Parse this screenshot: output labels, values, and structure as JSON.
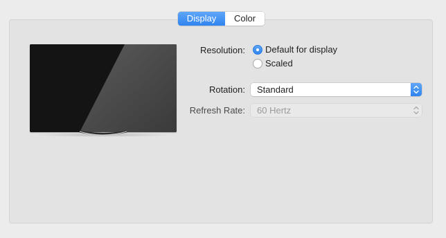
{
  "tabs": [
    {
      "label": "Display",
      "selected": true
    },
    {
      "label": "Color",
      "selected": false
    }
  ],
  "resolution": {
    "label": "Resolution:",
    "options": [
      {
        "label": "Default for display",
        "selected": true
      },
      {
        "label": "Scaled",
        "selected": false
      }
    ]
  },
  "rotation": {
    "label": "Rotation:",
    "value": "Standard",
    "enabled": true
  },
  "refresh_rate": {
    "label": "Refresh Rate:",
    "value": "60 Hertz",
    "enabled": false
  },
  "colors": {
    "accent": "#2f84f0",
    "panel": "#e3e3e3",
    "window": "#ececec"
  }
}
